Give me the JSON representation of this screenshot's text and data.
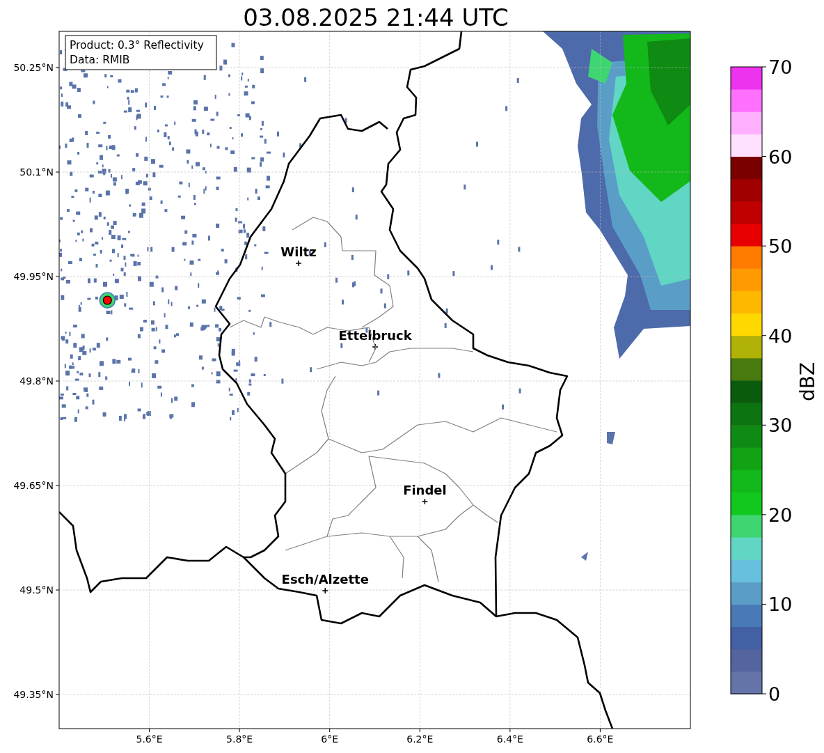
{
  "title": "03.08.2025 21:44 UTC",
  "info_box": [
    "Product: 0.3° Reflectivity",
    "Data: RMIB"
  ],
  "map": {
    "chart_data": {
      "type": "scatter",
      "grid": true,
      "xlim": [
        5.4,
        6.8
      ],
      "ylim": [
        49.301,
        50.302
      ],
      "xticks": [
        {
          "value": 5.6,
          "label": "5.6°E"
        },
        {
          "value": 5.8,
          "label": "5.8°E"
        },
        {
          "value": 6.0,
          "label": "6°E"
        },
        {
          "value": 6.2,
          "label": "6.2°E"
        },
        {
          "value": 6.4,
          "label": "6.4°E"
        },
        {
          "value": 6.6,
          "label": "6.6°E"
        }
      ],
      "yticks": [
        {
          "value": 50.25,
          "label": "50.25°N"
        },
        {
          "value": 50.1,
          "label": "50.1°N"
        },
        {
          "value": 49.95,
          "label": "49.95°N"
        },
        {
          "value": 49.8,
          "label": "49.8°N"
        },
        {
          "value": 49.65,
          "label": "49.65°N"
        },
        {
          "value": 49.5,
          "label": "49.5°N"
        },
        {
          "value": 49.35,
          "label": "49.35°N"
        }
      ],
      "series": [
        {
          "color": "#000000",
          "x": [
            5.931,
            6.101,
            6.211,
            5.99
          ],
          "values": [
            49.969,
            49.849,
            49.627,
            49.499
          ]
        },
        {
          "color": "#ff0000",
          "x": [
            5.507
          ],
          "values": [
            49.916
          ]
        }
      ],
      "annotations": [
        {
          "text": "Wiltz",
          "x": 5.931,
          "y": 49.969
        },
        {
          "text": "Ettelbruck",
          "x": 6.101,
          "y": 49.849
        },
        {
          "text": "Findel",
          "x": 6.211,
          "y": 49.627
        },
        {
          "text": "Esch/Alzette",
          "x": 5.99,
          "y": 49.499
        }
      ]
    }
  },
  "colorbar": {
    "label": "dBZ",
    "ticks": [
      "70",
      "60",
      "50",
      "40",
      "30",
      "20",
      "10",
      "0"
    ],
    "segments": [
      {
        "color": "#6574a8"
      },
      {
        "color": "#54649e"
      },
      {
        "color": "#4360a5"
      },
      {
        "color": "#4a7ab5"
      },
      {
        "color": "#5a9ec8"
      },
      {
        "color": "#67c1de"
      },
      {
        "color": "#62d6c4"
      },
      {
        "color": "#3ed670"
      },
      {
        "color": "#12c81f"
      },
      {
        "color": "#13b81a"
      },
      {
        "color": "#12a315"
      },
      {
        "color": "#0f8a12"
      },
      {
        "color": "#0c7410"
      },
      {
        "color": "#0a5c0c"
      },
      {
        "color": "#487a10"
      },
      {
        "color": "#b0b208"
      },
      {
        "color": "#ffd800"
      },
      {
        "color": "#ffb800"
      },
      {
        "color": "#ff9a00"
      },
      {
        "color": "#ff7c00"
      },
      {
        "color": "#e80000"
      },
      {
        "color": "#c00000"
      },
      {
        "color": "#a00000"
      },
      {
        "color": "#7a0000"
      },
      {
        "color": "#ffe0ff"
      },
      {
        "color": "#ffb0ff"
      },
      {
        "color": "#ff70ff"
      },
      {
        "color": "#ee33ee"
      }
    ]
  }
}
